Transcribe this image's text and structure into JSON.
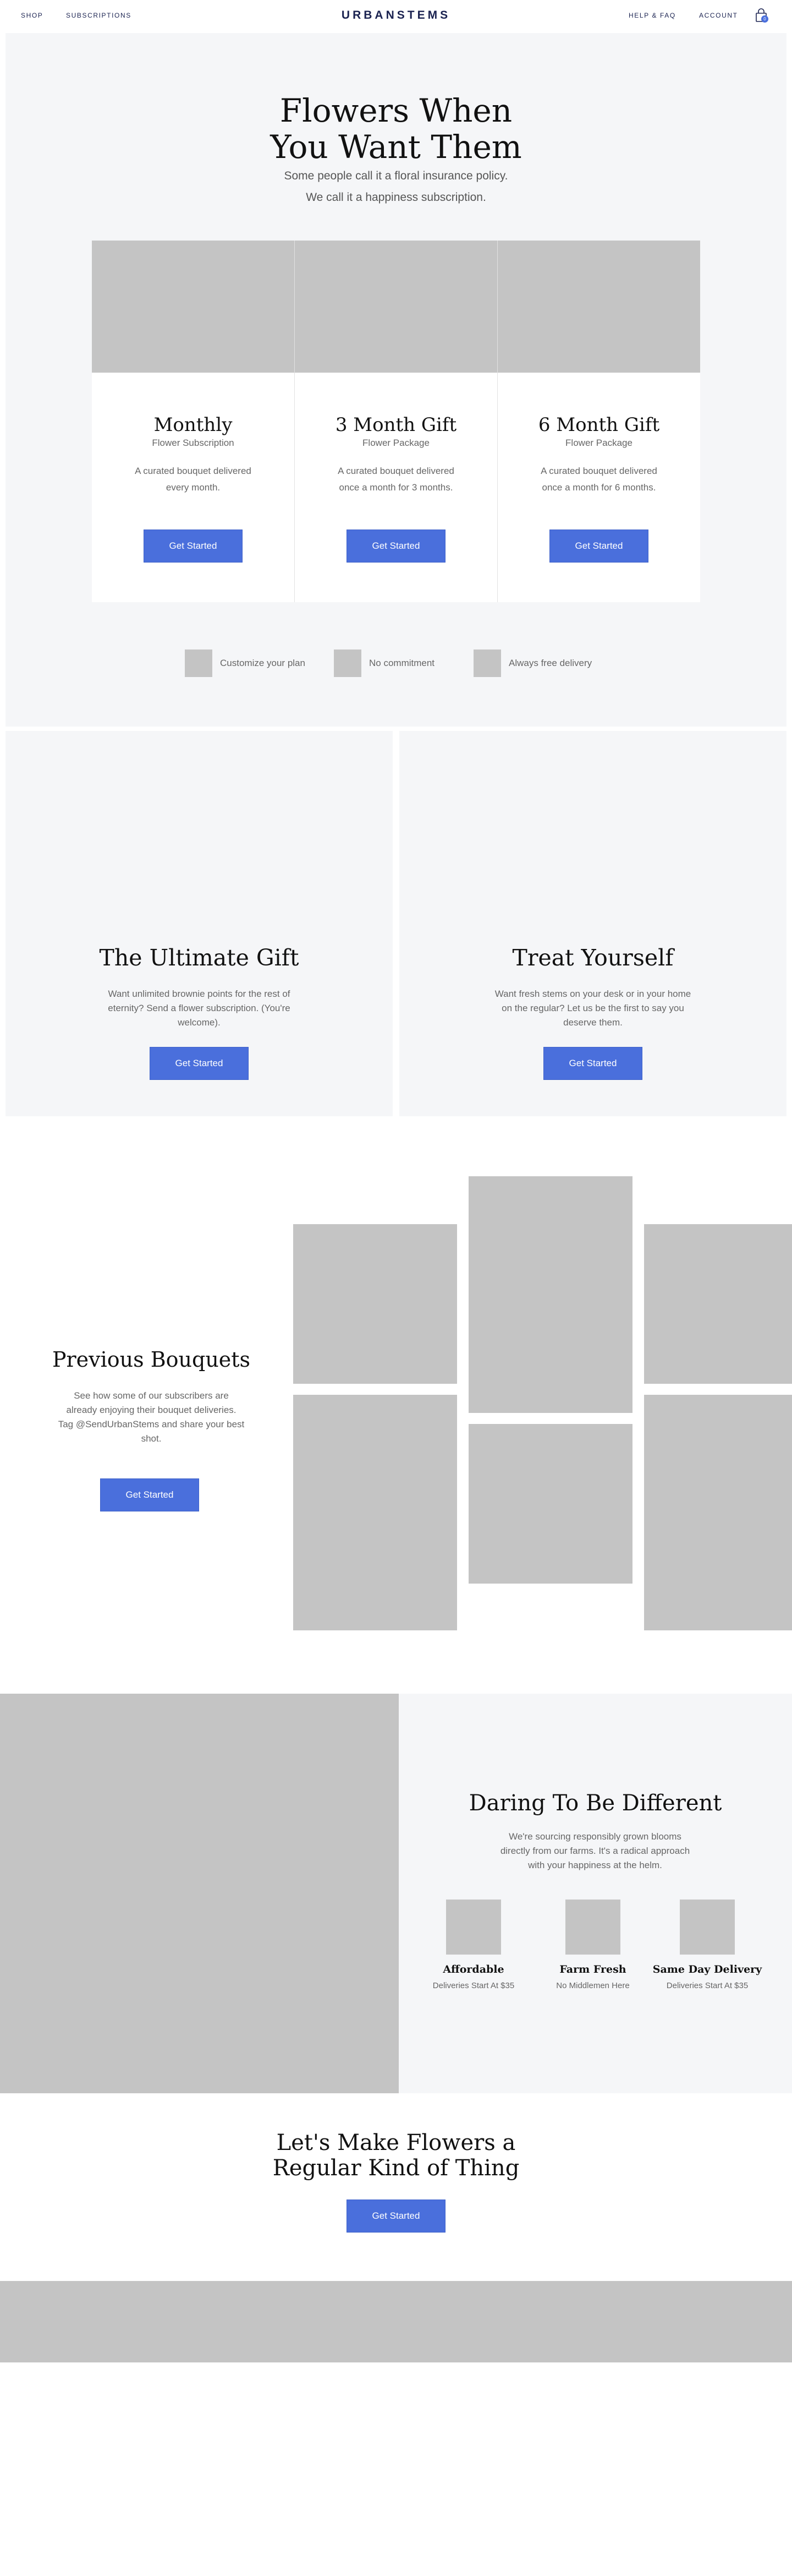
{
  "nav": {
    "left_links": [
      "SHOP",
      "SUBSCRIPTIONS"
    ],
    "brand": "URBANSTEMS",
    "right_links": [
      "HELP & FAQ",
      "ACCOUNT"
    ],
    "cart_count": "0"
  },
  "hero": {
    "title_line1": "Flowers When",
    "title_line2": "You Want Them",
    "subtitle_line1": "Some people call it a floral insurance policy.",
    "subtitle_line2": "We call it a happiness subscription.",
    "plans": [
      {
        "title": "Monthly",
        "kind": "Flower Subscription",
        "desc": "A curated bouquet delivered every month.",
        "button": "Get Started"
      },
      {
        "title": "3 Month Gift",
        "kind": "Flower Package",
        "desc": "A curated bouquet delivered once a month for 3 months.",
        "button": "Get Started"
      },
      {
        "title": "6 Month Gift",
        "kind": "Flower Package",
        "desc": "A curated bouquet delivered once a month for 6 months.",
        "button": "Get Started"
      }
    ],
    "features": [
      "Customize your plan",
      "No commitment",
      "Always free delivery"
    ]
  },
  "promos": [
    {
      "title": "The Ultimate Gift",
      "text": "Want unlimited brownie points for the rest of eternity? Send a flower subscription. (You're welcome).",
      "button": "Get Started"
    },
    {
      "title": "Treat Yourself",
      "text": "Want fresh stems on your desk or in your home on the regular? Let us be the first to say you deserve them.",
      "button": "Get Started"
    }
  ],
  "previous": {
    "title": "Previous Bouquets",
    "text": "See how some of our subscribers are already enjoying their bouquet deliveries. Tag @SendUrbanStems and share your best shot.",
    "button": "Get Started"
  },
  "daring": {
    "title": "Daring To Be Different",
    "text": "We're sourcing responsibly grown blooms directly from our farms. It's a radical approach with your happiness at the helm.",
    "features": [
      {
        "title": "Affordable",
        "sub": "Deliveries Start At $35"
      },
      {
        "title": "Farm Fresh",
        "sub": "No Middlemen Here"
      },
      {
        "title": "Same Day Delivery",
        "sub": "Deliveries Start At $35"
      }
    ]
  },
  "cta": {
    "title_line1": "Let's Make Flowers a",
    "title_line2": "Regular Kind of Thing",
    "button": "Get Started"
  },
  "colors": {
    "accent": "#4a6fdc",
    "navy": "#1a2250",
    "panel": "#f5f6f8",
    "placeholder": "#c4c4c4"
  }
}
